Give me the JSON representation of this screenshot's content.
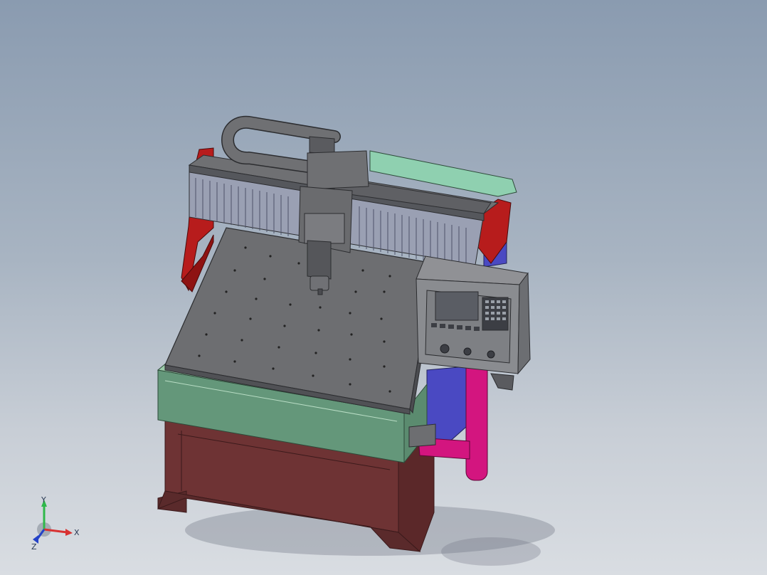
{
  "viewport": {
    "triad": {
      "x_label": "X",
      "y_label": "Y",
      "z_label": "Z",
      "x_color": "#d83232",
      "y_color": "#2fb84a",
      "z_color": "#2442c8"
    }
  },
  "model": {
    "frame_color": "#6e3334",
    "guard_color": "#64977a",
    "bed_color": "#6d6e71",
    "gantry_color": "#6f7073",
    "end_cap_color": "#b71c1c",
    "panel_color": "#8a8c90",
    "side_panel_color": "#4a49c2",
    "arm_color": "#d3157f"
  }
}
